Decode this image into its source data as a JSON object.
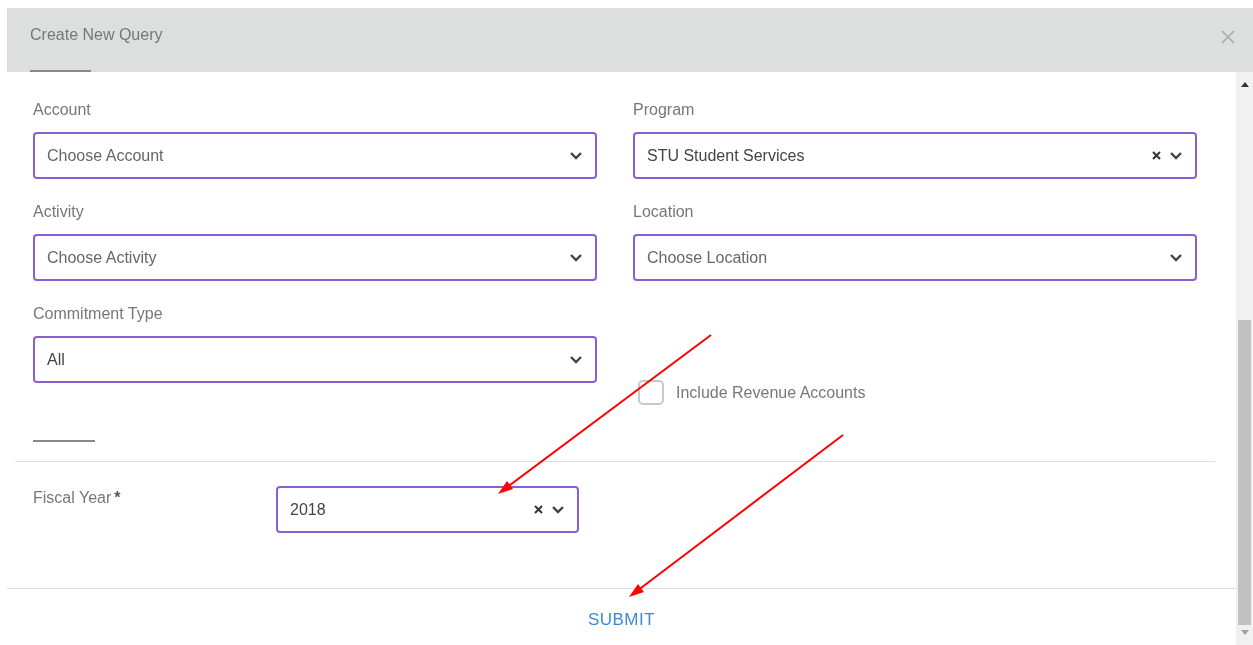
{
  "dialog": {
    "title": "Create New Query"
  },
  "fields": [
    {
      "label": "Account",
      "placeholder": "Choose Account",
      "clearable": false
    },
    {
      "label": "Program",
      "value": "STU Student Services",
      "clearable": true
    },
    {
      "label": "Activity",
      "placeholder": "Choose Activity",
      "clearable": false
    },
    {
      "label": "Location",
      "placeholder": "Choose Location",
      "clearable": false
    },
    {
      "label": "Commitment Type",
      "value": "All",
      "clearable": false
    }
  ],
  "checkbox": {
    "label": "Include Revenue Accounts",
    "checked": false
  },
  "fiscal_year": {
    "label": "Fiscal Year",
    "required": true,
    "required_mark": "*",
    "value": "2018",
    "clearable": true
  },
  "submit": {
    "label": "SUBMIT"
  }
}
